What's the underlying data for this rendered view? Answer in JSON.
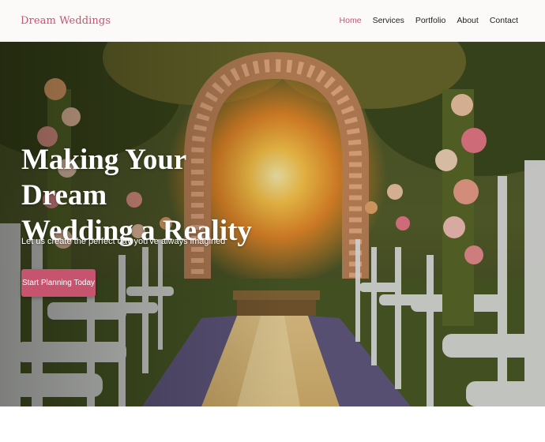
{
  "brand": {
    "name": "Dream Weddings"
  },
  "nav": {
    "items": [
      {
        "label": "Home",
        "active": true
      },
      {
        "label": "Services",
        "active": false
      },
      {
        "label": "Portfolio",
        "active": false
      },
      {
        "label": "About",
        "active": false
      },
      {
        "label": "Contact",
        "active": false
      }
    ]
  },
  "hero": {
    "title": "Making Your Dream\nWedding a Reality",
    "subtitle": "Let us create the perfect day you've always imagined",
    "cta_label": "Start Planning Today"
  },
  "colors": {
    "accent": "#c2566f",
    "button": "#c6546e",
    "header_bg": "#fbfaf9"
  }
}
